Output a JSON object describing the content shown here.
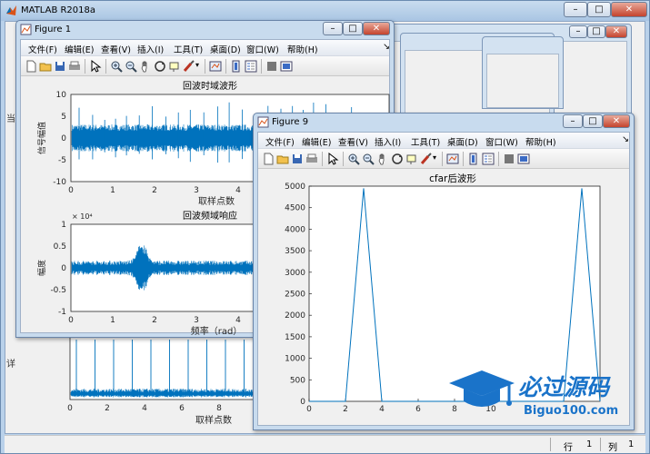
{
  "app": {
    "title": "MATLAB R2018a"
  },
  "status": {
    "row_label": "行",
    "row_value": "1",
    "col_label": "列",
    "col_value": "1"
  },
  "menu_items": [
    "文件(F)",
    "编辑(E)",
    "查看(V)",
    "插入(I)",
    "工具(T)",
    "桌面(D)",
    "窗口(W)",
    "帮助(H)"
  ],
  "figure1": {
    "title": "Figure 1",
    "plots": [
      {
        "title": "回波时域波形",
        "xlabel": "取样点数",
        "ylabel": "信号幅值",
        "yticks": [
          "10",
          "5",
          "0",
          "-5",
          "-10"
        ],
        "xticks": [
          "0",
          "1",
          "2",
          "3",
          "4"
        ]
      },
      {
        "title": "回波频域响应",
        "xlabel": "频率（rad）",
        "ylabel": "幅度",
        "exponent": "× 10⁴",
        "yticks": [
          "1",
          "0.5",
          "0",
          "-0.5",
          "-1"
        ],
        "xticks": [
          "0",
          "1",
          "2",
          "3",
          "4"
        ]
      }
    ],
    "lower_plot": {
      "xlabel": "取样点数",
      "xticks": [
        "0",
        "2",
        "4",
        "6",
        "8"
      ]
    },
    "side_labels": [
      "当",
      "详"
    ]
  },
  "figure9": {
    "title": "Figure 9",
    "partial_xtick": "10"
  },
  "chart_data": {
    "type": "line",
    "title": "cfar后波形",
    "x": [
      0,
      1,
      2,
      3,
      4,
      5,
      6,
      7,
      8,
      9,
      10,
      11,
      12,
      13,
      14,
      15,
      16
    ],
    "y": [
      0,
      0,
      0,
      4950,
      0,
      0,
      0,
      0,
      0,
      0,
      0,
      0,
      0,
      0,
      0,
      4950,
      0
    ],
    "xlim": [
      0,
      16
    ],
    "ylim": [
      0,
      5000
    ],
    "yticks": [
      0,
      500,
      1000,
      1500,
      2000,
      2500,
      3000,
      3500,
      4000,
      4500,
      5000
    ],
    "xticks": [
      0,
      2,
      4,
      6,
      8,
      10
    ],
    "grid": false,
    "color": "#0072bd"
  },
  "watermark": {
    "cn": "必过源码",
    "en": "Biguo100.com"
  },
  "colors": {
    "signal": "#0072bd",
    "titlebar": "#c8dbee",
    "figure_bg": "#f0f0f0"
  }
}
